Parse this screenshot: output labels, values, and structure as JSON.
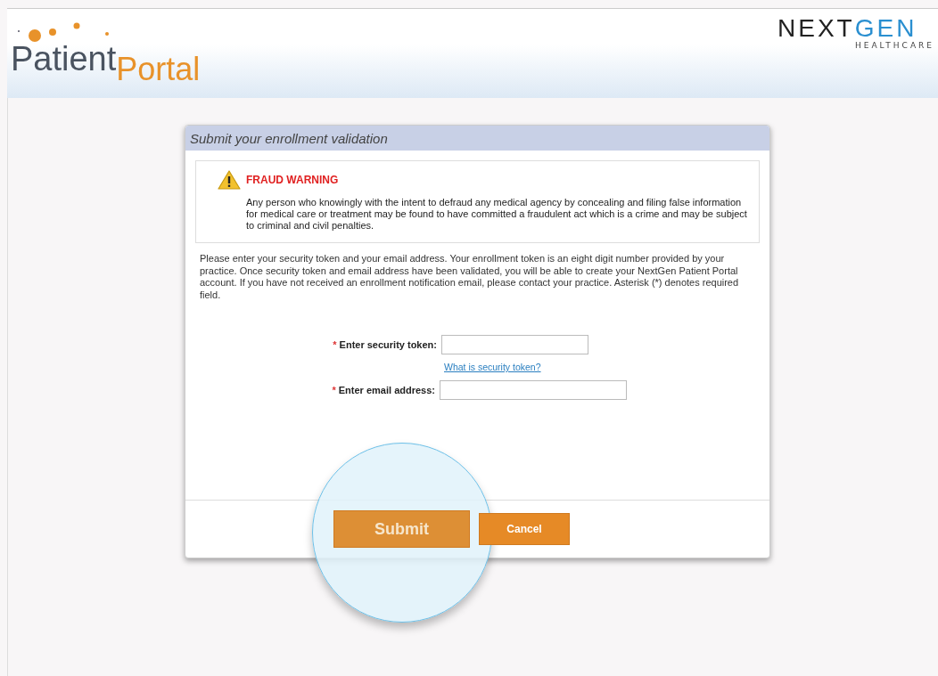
{
  "header": {
    "logo": {
      "word_1": "Patient",
      "word_2": "Portal"
    },
    "brand": {
      "word_1": "NEXT",
      "word_2": "GEN",
      "tagline": "HEALTHCARE"
    }
  },
  "panel": {
    "title": "Submit your enrollment validation",
    "warning": {
      "heading": "FRAUD WARNING",
      "text": "Any person who knowingly with the intent to defraud any medical agency by concealing and filing false information for medical care or treatment may be found to have committed a fraudulent act which is a crime and may be subject to criminal and civil penalties."
    },
    "instructions": "Please enter your security token and your email address. Your enrollment token is an eight digit number provided by your practice. Once security token and email address have been validated, you will be able to create your NextGen Patient Portal account. If you have not received an enrollment notification email, please contact your practice. Asterisk (*) denotes required field.",
    "fields": [
      {
        "kind": "token",
        "required_mark": "*",
        "label": "Enter security token:",
        "help_link": "What is security token?"
      },
      {
        "kind": "email",
        "required_mark": "*",
        "label": "Enter email address:"
      }
    ],
    "buttons": [
      {
        "label": "Submit",
        "magnified": true
      },
      {
        "label": "Cancel",
        "magnified": false
      }
    ]
  }
}
